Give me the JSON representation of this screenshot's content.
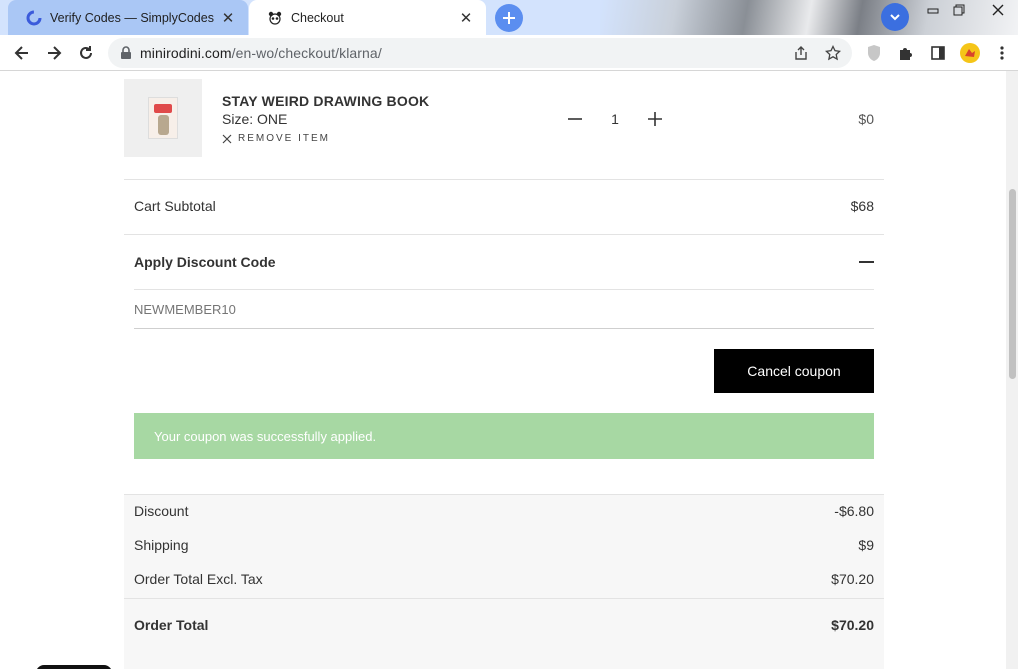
{
  "browser": {
    "tabs": [
      {
        "title": "Verify Codes — SimplyCodes",
        "active": false
      },
      {
        "title": "Checkout",
        "active": true
      }
    ],
    "url_domain": "minirodini.com",
    "url_path": "/en-wo/checkout/klarna/"
  },
  "cart": {
    "product": {
      "name": "STAY WEIRD DRAWING BOOK",
      "size": "Size: ONE",
      "remove_label": "REMOVE ITEM",
      "quantity": "1",
      "price": "$0"
    },
    "subtotal_label": "Cart Subtotal",
    "subtotal_value": "$68",
    "discount_code_label": "Apply Discount Code",
    "coupon_placeholder": "NEWMEMBER10",
    "cancel_coupon_label": "Cancel coupon",
    "success_message": "Your coupon was successfully applied.",
    "totals": {
      "discount_label": "Discount",
      "discount_value": "-$6.80",
      "shipping_label": "Shipping",
      "shipping_value": "$9",
      "excl_tax_label": "Order Total Excl. Tax",
      "excl_tax_value": "$70.20",
      "order_total_label": "Order Total",
      "order_total_value": "$70.20"
    }
  },
  "colors": {
    "success_bg": "#a7d8a3",
    "button_bg": "#000000",
    "tabbar_bg": "#d3e3fd"
  }
}
